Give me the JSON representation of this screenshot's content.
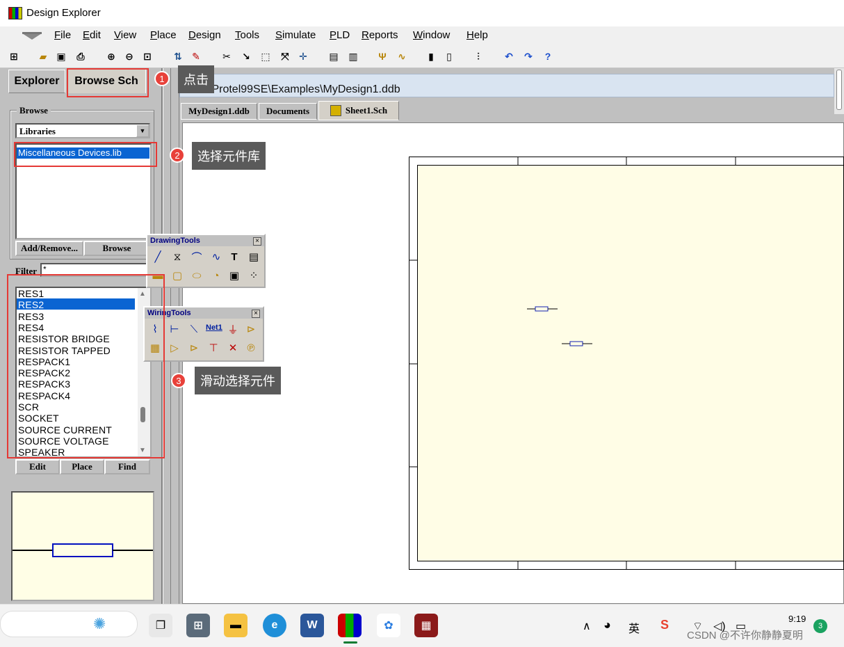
{
  "window": {
    "title": "Design Explorer"
  },
  "menu": [
    "File",
    "Edit",
    "View",
    "Place",
    "Design",
    "Tools",
    "Simulate",
    "PLD",
    "Reports",
    "Window",
    "Help"
  ],
  "panel": {
    "tabs": [
      "Explorer",
      "Browse Sch"
    ],
    "browse_label": "Browse",
    "browse_type": "Libraries",
    "library": "Miscellaneous Devices.lib",
    "btn_add_remove": "Add/Remove...",
    "btn_browse": "Browse",
    "filter_label": "Filter",
    "filter_value": "*",
    "components": [
      "RES1",
      "RES2",
      "RES3",
      "RES4",
      "RESISTOR BRIDGE",
      "RESISTOR TAPPED",
      "RESPACK1",
      "RESPACK2",
      "RESPACK3",
      "RESPACK4",
      "SCR",
      "SOCKET",
      "SOURCE CURRENT",
      "SOURCE VOLTAGE",
      "SPEAKER"
    ],
    "selected_component": "RES2",
    "btn_edit": "Edit",
    "btn_place": "Place",
    "btn_find": "Find"
  },
  "document": {
    "path": "D:\\Protel99SE\\Examples\\MyDesign1.ddb",
    "tabs": [
      "MyDesign1.ddb",
      "Documents",
      "Sheet1.Sch"
    ]
  },
  "drawing_tools": {
    "title": "DrawingTools"
  },
  "wiring_tools": {
    "title": "WiringTools",
    "net_label": "Net1"
  },
  "annotations": [
    {
      "num": "1",
      "text": "点击"
    },
    {
      "num": "2",
      "text": "选择元件库"
    },
    {
      "num": "3",
      "text": "滑动选择元件"
    }
  ],
  "taskbar": {
    "time": "9:19",
    "ime": "英",
    "watermark": "CSDN @不许你静静夏明",
    "notify_count": "3"
  },
  "colors": {
    "selection": "#0a64d2",
    "annotation": "#e53935",
    "sheet": "#fffde6"
  }
}
